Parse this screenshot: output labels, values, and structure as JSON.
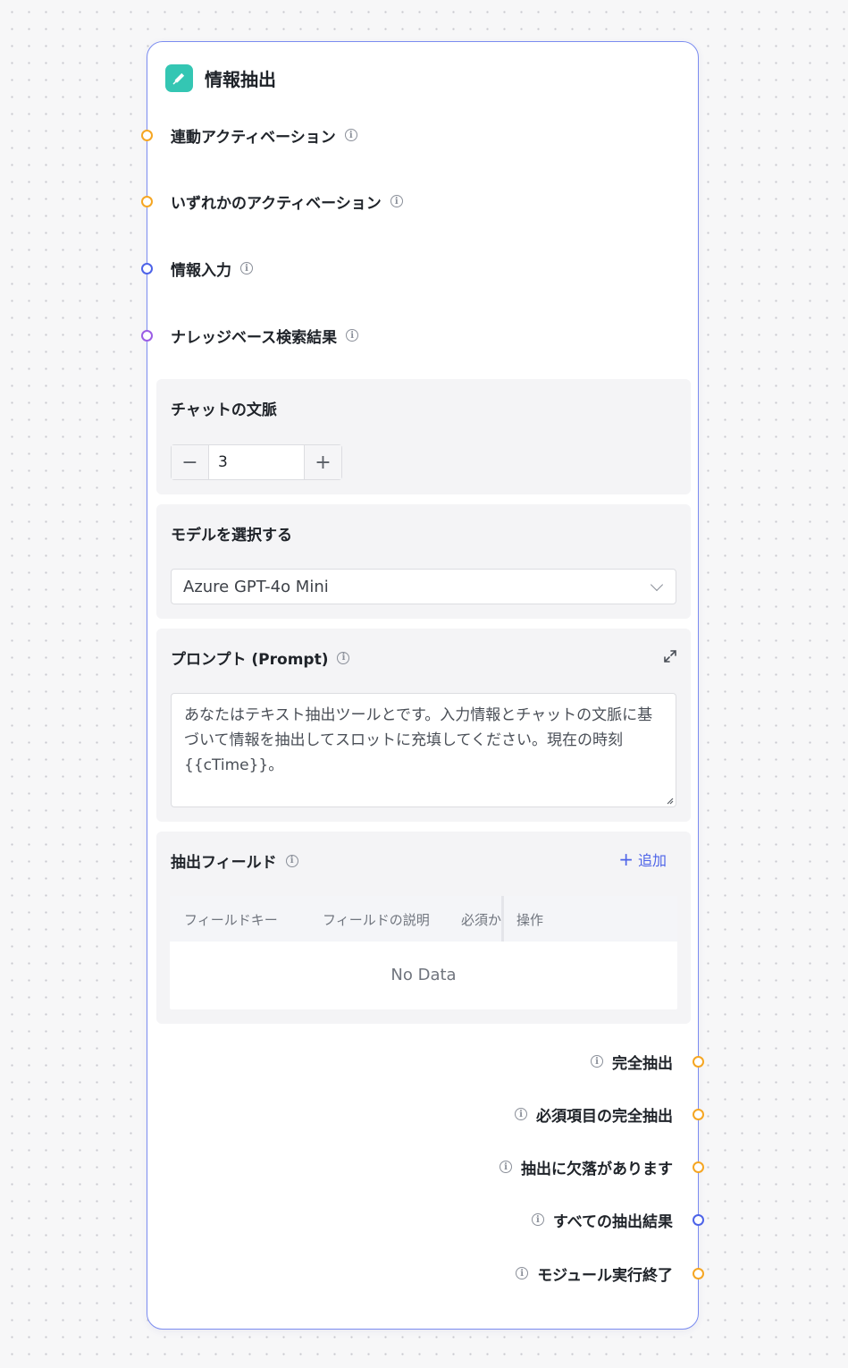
{
  "node": {
    "title": "情報抽出",
    "icon": "edit-pen-icon",
    "accent_color": "#34c6b3",
    "border_color": "#7b8cf0"
  },
  "inputs": [
    {
      "label": "連動アクティベーション",
      "port_color": "orange"
    },
    {
      "label": "いずれかのアクティベーション",
      "port_color": "orange"
    },
    {
      "label": "情報入力",
      "port_color": "blue"
    },
    {
      "label": "ナレッジベース検索結果",
      "port_color": "purple"
    }
  ],
  "chat_context": {
    "title": "チャットの文脈",
    "value": "3",
    "minus_label": "−",
    "plus_label": "+"
  },
  "model": {
    "title": "モデルを選択する",
    "selected": "Azure GPT-4o Mini"
  },
  "prompt": {
    "title": "プロンプト (Prompt)",
    "text": "あなたはテキスト抽出ツールとです。入力情報とチャットの文脈に基づいて情報を抽出してスロットに充填してください。現在の時刻{{cTime}}。"
  },
  "fields": {
    "title": "抽出フィールド",
    "add_label": "追加",
    "columns": [
      "フィールドキー",
      "フィールドの説明",
      "必須か",
      "操作"
    ],
    "empty_text": "No Data"
  },
  "outputs": [
    {
      "label": "完全抽出",
      "port_color": "orange"
    },
    {
      "label": "必須項目の完全抽出",
      "port_color": "orange"
    },
    {
      "label": "抽出に欠落があります",
      "port_color": "orange"
    },
    {
      "label": "すべての抽出結果",
      "port_color": "blue"
    },
    {
      "label": "モジュール実行終了",
      "port_color": "orange"
    }
  ]
}
